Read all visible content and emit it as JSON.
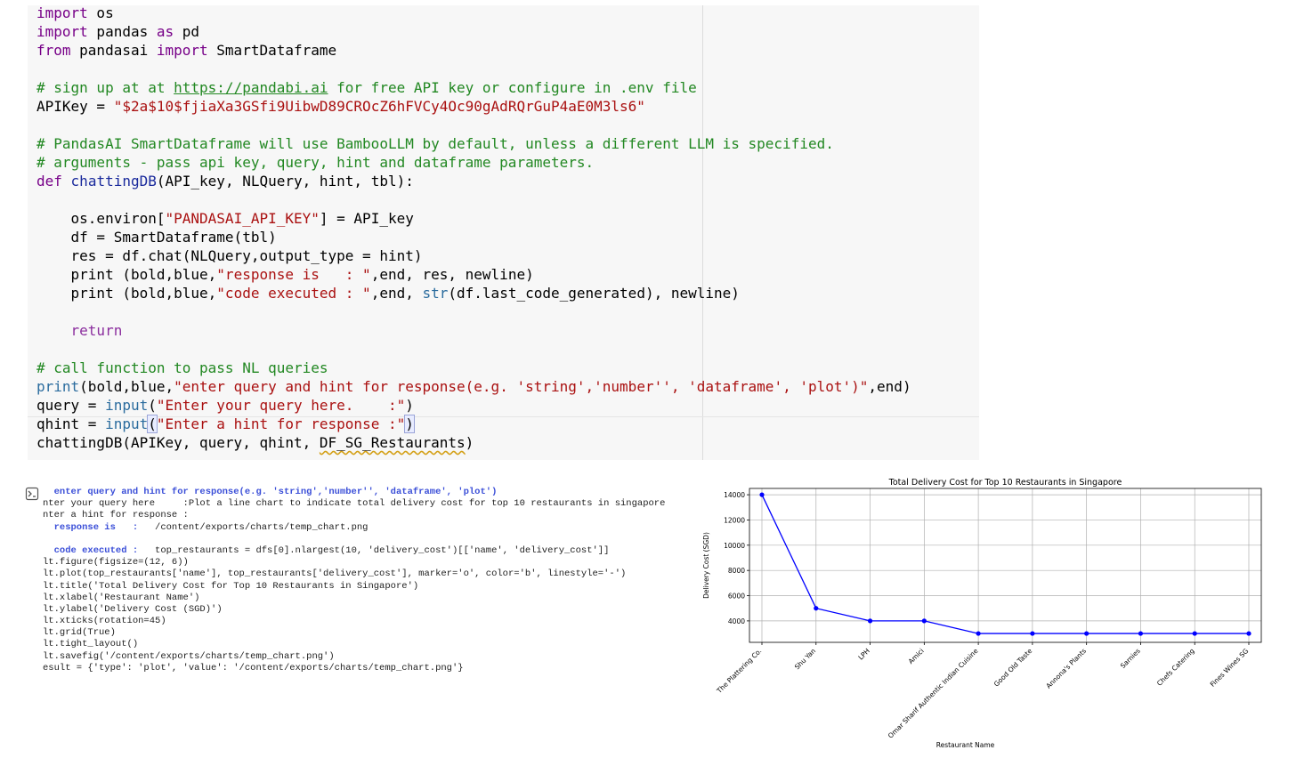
{
  "code_cell": {
    "lines": [
      [
        [
          "kw",
          "import"
        ],
        [
          "plain",
          " os"
        ]
      ],
      [
        [
          "kw",
          "import"
        ],
        [
          "plain",
          " pandas "
        ],
        [
          "kw",
          "as"
        ],
        [
          "plain",
          " pd"
        ]
      ],
      [
        [
          "kw",
          "from"
        ],
        [
          "plain",
          " pandasai "
        ],
        [
          "kw",
          "import"
        ],
        [
          "plain",
          " SmartDataframe"
        ]
      ],
      [],
      [
        [
          "com",
          "# sign up at at "
        ],
        [
          "link",
          "https://pandabi.ai"
        ],
        [
          "com",
          " for free API key or configure in .env file"
        ]
      ],
      [
        [
          "plain",
          "APIKey = "
        ],
        [
          "str",
          "\"$2a$10$fjiaXa3GSfi9UibwD89CROcZ6hFVCy4Oc90gAdRQrGuP4aE0M3ls6\""
        ]
      ],
      [],
      [
        [
          "com",
          "# PandasAI SmartDataframe will use BambooLLM by default, unless a different LLM is specified."
        ]
      ],
      [
        [
          "com",
          "# arguments - pass api key, query, hint and dataframe parameters."
        ]
      ],
      [
        [
          "kw",
          "def"
        ],
        [
          "plain",
          " "
        ],
        [
          "def",
          "chattingDB"
        ],
        [
          "plain",
          "(API_key, NLQuery, hint, tbl):"
        ]
      ],
      [],
      [
        [
          "plain",
          "    os.environ["
        ],
        [
          "str",
          "\"PANDASAI_API_KEY\""
        ],
        [
          "plain",
          "] = API_key"
        ]
      ],
      [
        [
          "plain",
          "    df = SmartDataframe(tbl)"
        ]
      ],
      [
        [
          "plain",
          "    res = df.chat(NLQuery,output_type = hint)"
        ]
      ],
      [
        [
          "plain",
          "    print (bold,blue,"
        ],
        [
          "str",
          "\"response is   : \""
        ],
        [
          "plain",
          ",end, res, newline)"
        ]
      ],
      [
        [
          "plain",
          "    print (bold,blue,"
        ],
        [
          "str",
          "\"code executed : \""
        ],
        [
          "plain",
          ",end, "
        ],
        [
          "builtin",
          "str"
        ],
        [
          "plain",
          "(df.last_code_generated), newline)"
        ]
      ],
      [],
      [
        [
          "kw2",
          "    return"
        ]
      ],
      [],
      [
        [
          "com",
          "# call function to pass NL queries"
        ]
      ],
      [
        [
          "builtin",
          "print"
        ],
        [
          "plain",
          "(bold,blue,"
        ],
        [
          "str",
          "\"enter query and hint for response(e.g. 'string','number'', 'dataframe', 'plot')\""
        ],
        [
          "plain",
          ",end)"
        ]
      ],
      [
        [
          "plain",
          "query = "
        ],
        [
          "builtin",
          "input"
        ],
        [
          "plain",
          "("
        ],
        [
          "str",
          "\"Enter your query here.    :\""
        ],
        [
          "plain",
          ")"
        ]
      ],
      [
        [
          "plain",
          "qhint = "
        ],
        [
          "builtin",
          "input"
        ],
        [
          "cursor",
          "("
        ],
        [
          "str",
          "\"Enter a hint for response :\""
        ],
        [
          "cursor",
          ")"
        ]
      ],
      [
        [
          "plain",
          "chattingDB(APIKey, query, qhint, "
        ],
        [
          "squiggle",
          "DF_SG_Restaurants"
        ],
        [
          "plain",
          ")"
        ]
      ]
    ]
  },
  "output": {
    "icon": "output-toggle-icon",
    "lines": [
      [
        [
          "bold",
          "  enter query and hint for response(e.g. 'string','number'', 'dataframe', 'plot')"
        ]
      ],
      [
        [
          "plain",
          "nter your query here     :Plot a line chart to indicate total delivery cost for top 10 restaurants in singapore"
        ]
      ],
      [
        [
          "plain",
          "nter a hint for response :"
        ]
      ],
      [
        [
          "bold",
          "  response is   :"
        ],
        [
          "plain",
          "   /content/exports/charts/temp_chart.png"
        ]
      ],
      [],
      [
        [
          "bold",
          "  code executed :"
        ],
        [
          "plain",
          "   top_restaurants = dfs[0].nlargest(10, 'delivery_cost')[['name', 'delivery_cost']]"
        ]
      ],
      [
        [
          "plain",
          "lt.figure(figsize=(12, 6))"
        ]
      ],
      [
        [
          "plain",
          "lt.plot(top_restaurants['name'], top_restaurants['delivery_cost'], marker='o', color='b', linestyle='-')"
        ]
      ],
      [
        [
          "plain",
          "lt.title('Total Delivery Cost for Top 10 Restaurants in Singapore')"
        ]
      ],
      [
        [
          "plain",
          "lt.xlabel('Restaurant Name')"
        ]
      ],
      [
        [
          "plain",
          "lt.ylabel('Delivery Cost (SGD)')"
        ]
      ],
      [
        [
          "plain",
          "lt.xticks(rotation=45)"
        ]
      ],
      [
        [
          "plain",
          "lt.grid(True)"
        ]
      ],
      [
        [
          "plain",
          "lt.tight_layout()"
        ]
      ],
      [
        [
          "plain",
          "lt.savefig('/content/exports/charts/temp_chart.png')"
        ]
      ],
      [
        [
          "plain",
          "esult = {'type': 'plot', 'value': '/content/exports/charts/temp_chart.png'}"
        ]
      ]
    ]
  },
  "chart_data": {
    "type": "line",
    "title": "Total Delivery Cost for Top 10 Restaurants in Singapore",
    "xlabel": "Restaurant Name",
    "ylabel": "Delivery Cost (SGD)",
    "categories": [
      "The Plattering Co.",
      "Shu Yan",
      "LPH",
      "Amici",
      "Omar Sharif Authentic Indian Cuisine",
      "Good Old Taste",
      "Annona's Plants",
      "Sarnies",
      "Chefs Catering",
      "Fines Wines SG"
    ],
    "values": [
      14000,
      5000,
      4000,
      4000,
      3000,
      3000,
      3000,
      3000,
      3000,
      3000
    ],
    "yticks": [
      4000,
      6000,
      8000,
      10000,
      12000,
      14000
    ],
    "ylim": [
      2300,
      14500
    ],
    "grid": true,
    "line_color": "#0000ff",
    "marker": "circle"
  }
}
